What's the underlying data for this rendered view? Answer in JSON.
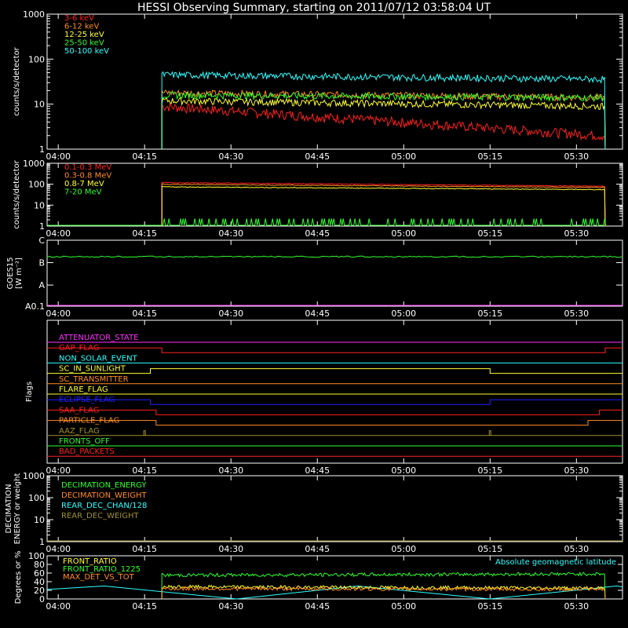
{
  "title": "HESSI Observing Summary, starting on 2011/07/12 03:58:04 UT",
  "time_ticks": [
    "04:00",
    "04:15",
    "04:30",
    "04:45",
    "05:00",
    "05:15",
    "05:30"
  ],
  "colors": {
    "red": "#ff2020",
    "orange": "#ff8c20",
    "yellow": "#ffff30",
    "green": "#30ff30",
    "cyan": "#30ffff",
    "magenta": "#ff30ff",
    "blue": "#2020ff",
    "olive": "#a09030",
    "white": "#ffffff"
  },
  "chart_data": [
    {
      "id": "panel_low",
      "type": "line",
      "ylabel": "counts/s/detector",
      "yscale": "log",
      "ylim": [
        1,
        1000
      ],
      "ytick_labels": [
        "1",
        "10",
        "100",
        "1000"
      ],
      "xlim": [
        "03:58:04",
        "05:38:00"
      ],
      "series": [
        {
          "name": "3-6 keV",
          "color": "red",
          "start": "04:18",
          "end": "05:35",
          "start_value": 9,
          "end_value": 2
        },
        {
          "name": "6-12 keV",
          "color": "orange",
          "start": "04:18",
          "end": "05:35",
          "start_value": 18,
          "end_value": 14
        },
        {
          "name": "12-25 keV",
          "color": "yellow",
          "start": "04:18",
          "end": "05:35",
          "start_value": 12,
          "end_value": 9
        },
        {
          "name": "25-50 keV",
          "color": "green",
          "start": "04:18",
          "end": "05:35",
          "start_value": 16,
          "end_value": 14
        },
        {
          "name": "50-100 keV",
          "color": "cyan",
          "start": "04:18",
          "end": "05:35",
          "start_value": 45,
          "end_value": 36
        }
      ]
    },
    {
      "id": "panel_high",
      "type": "line",
      "ylabel": "counts/s/detector",
      "yscale": "log",
      "ylim": [
        1,
        1000
      ],
      "ytick_labels": [
        "1",
        "10",
        "100",
        "1000"
      ],
      "series": [
        {
          "name": "0.1-0.3 MeV",
          "color": "red",
          "start": "04:18",
          "end": "05:35",
          "start_value": 120,
          "end_value": 80
        },
        {
          "name": "0.3-0.8 MeV",
          "color": "orange",
          "start": "04:18",
          "end": "05:35",
          "start_value": 100,
          "end_value": 70
        },
        {
          "name": "0.8-7 MeV",
          "color": "yellow",
          "start": "04:18",
          "end": "05:35",
          "start_value": 75,
          "end_value": 55
        },
        {
          "name": "7-20 MeV",
          "color": "green",
          "start": "04:18",
          "end": "05:35",
          "start_value": 1,
          "end_value": 1
        }
      ]
    },
    {
      "id": "panel_goes",
      "type": "line",
      "ylabel_lines": [
        "GOES15",
        "[W m⁻²]"
      ],
      "ytick_labels": [
        "A0.1",
        "A",
        "B",
        "C"
      ],
      "series": [
        {
          "name": "",
          "color": "green",
          "start": "03:58:04",
          "end": "05:38:00",
          "start_value": "B",
          "end_value": "B"
        }
      ]
    },
    {
      "id": "panel_flags",
      "type": "line",
      "ylabel": "Flags",
      "flags": [
        {
          "name": "ATTENUATOR_STATE",
          "color": "magenta",
          "changes": []
        },
        {
          "name": "GAP_FLAG",
          "color": "red",
          "changes": [
            "04:18",
            "05:35"
          ],
          "high_at_start": true
        },
        {
          "name": "NON_SOLAR_EVENT",
          "color": "cyan",
          "changes": []
        },
        {
          "name": "SC_IN_SUNLIGHT",
          "color": "yellow",
          "changes": [
            "04:16",
            "05:15"
          ],
          "high_at_start": false
        },
        {
          "name": "SC_TRANSMITTER",
          "color": "orange",
          "changes": []
        },
        {
          "name": "FLARE_FLAG",
          "color": "yellow",
          "changes": []
        },
        {
          "name": "ECLIPSE_FLAG",
          "color": "blue",
          "changes": [
            "04:16",
            "05:15"
          ],
          "high_at_start": true
        },
        {
          "name": "SAA_FLAG",
          "color": "red",
          "changes": [
            "04:17",
            "05:34"
          ],
          "high_at_start": true
        },
        {
          "name": "PARTICLE_FLAG",
          "color": "orange",
          "changes": [
            "04:17",
            "05:32"
          ],
          "high_at_start": true
        },
        {
          "name": "AAZ_FLAG",
          "color": "olive",
          "changes": [],
          "spikes": [
            "04:15",
            "05:15"
          ]
        },
        {
          "name": "FRONTS_OFF",
          "color": "green",
          "changes": []
        },
        {
          "name": "BAD_PACKETS",
          "color": "red",
          "changes": []
        }
      ]
    },
    {
      "id": "panel_decim",
      "type": "line",
      "ylabel_lines": [
        "DECIMATION",
        "ENERGY or weight"
      ],
      "yscale": "log",
      "ylim": [
        1,
        1000
      ],
      "ytick_labels": [
        "1",
        "10",
        "100",
        "1000"
      ],
      "series": [
        {
          "name": "DECIMATION_ENERGY",
          "color": "green"
        },
        {
          "name": "DECIMATION_WEIGHT",
          "color": "orange"
        },
        {
          "name": "REAR_DEC_CHAN/128",
          "color": "cyan"
        },
        {
          "name": "REAR_DEC_WEIGHT",
          "color": "olive"
        }
      ]
    },
    {
      "id": "panel_ratio",
      "type": "line",
      "ylabel": "Degrees or %",
      "ylim": [
        0,
        100
      ],
      "ytick_labels": [
        "0",
        "20",
        "40",
        "60",
        "80",
        "100"
      ],
      "annotation": "Absolute geomagnetic latitude",
      "series": [
        {
          "name": "FRONT_RATIO",
          "color": "yellow",
          "start": "04:18",
          "end": "05:35",
          "start_value": 28,
          "end_value": 25
        },
        {
          "name": "FRONT_RATIO_1225",
          "color": "green",
          "start": "04:18",
          "end": "05:35",
          "start_value": 55,
          "end_value": 58
        },
        {
          "name": "MAX_DET_VS_TOT",
          "color": "orange",
          "start": "04:18",
          "end": "05:35",
          "start_value": 24,
          "end_value": 22
        },
        {
          "name": "",
          "color": "cyan",
          "kind": "latitude",
          "max_value": 30,
          "zero_times": [
            "04:31",
            "05:15"
          ],
          "peak_times": [
            "04:08",
            "04:52",
            "05:37"
          ]
        }
      ]
    }
  ]
}
